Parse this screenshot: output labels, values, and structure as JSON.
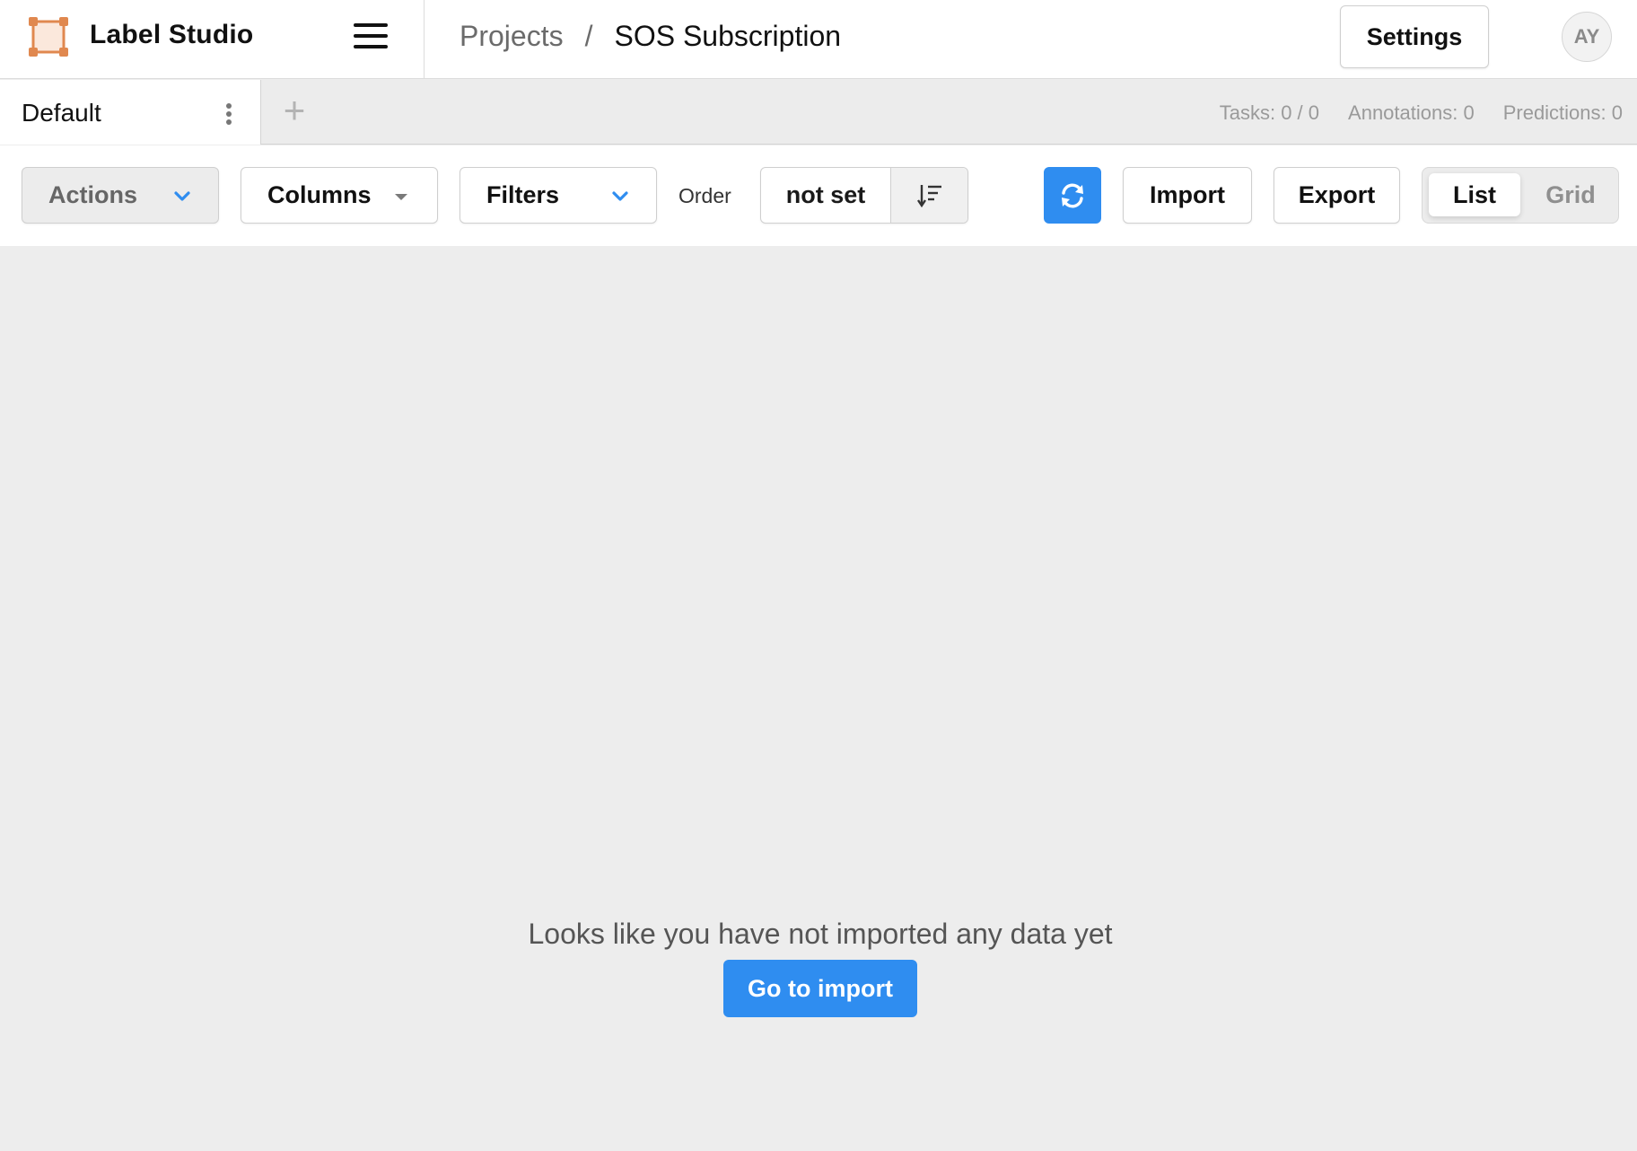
{
  "app": {
    "name": "Label Studio"
  },
  "breadcrumb": {
    "parent": "Projects",
    "separator": "/",
    "current": "SOS Subscription"
  },
  "header": {
    "settings_label": "Settings",
    "avatar_initials": "AY"
  },
  "tabs": {
    "active_label": "Default",
    "add_label": "+"
  },
  "stats": {
    "tasks": "Tasks: 0 / 0",
    "annotations": "Annotations: 0",
    "predictions": "Predictions: 0"
  },
  "toolbar": {
    "actions_label": "Actions",
    "columns_label": "Columns",
    "filters_label": "Filters",
    "order_label": "Order",
    "order_value": "not set",
    "import_label": "Import",
    "export_label": "Export",
    "view_list_label": "List",
    "view_grid_label": "Grid"
  },
  "empty_state": {
    "message": "Looks like you have not imported any data yet",
    "button_label": "Go to import"
  },
  "colors": {
    "accent": "#2f8df0",
    "logo": "#e0884f"
  },
  "icons": [
    "logo-icon",
    "hamburger-icon",
    "kebab-icon",
    "plus-icon",
    "chevron-down-icon",
    "caret-down-icon",
    "sort-icon",
    "refresh-icon"
  ]
}
